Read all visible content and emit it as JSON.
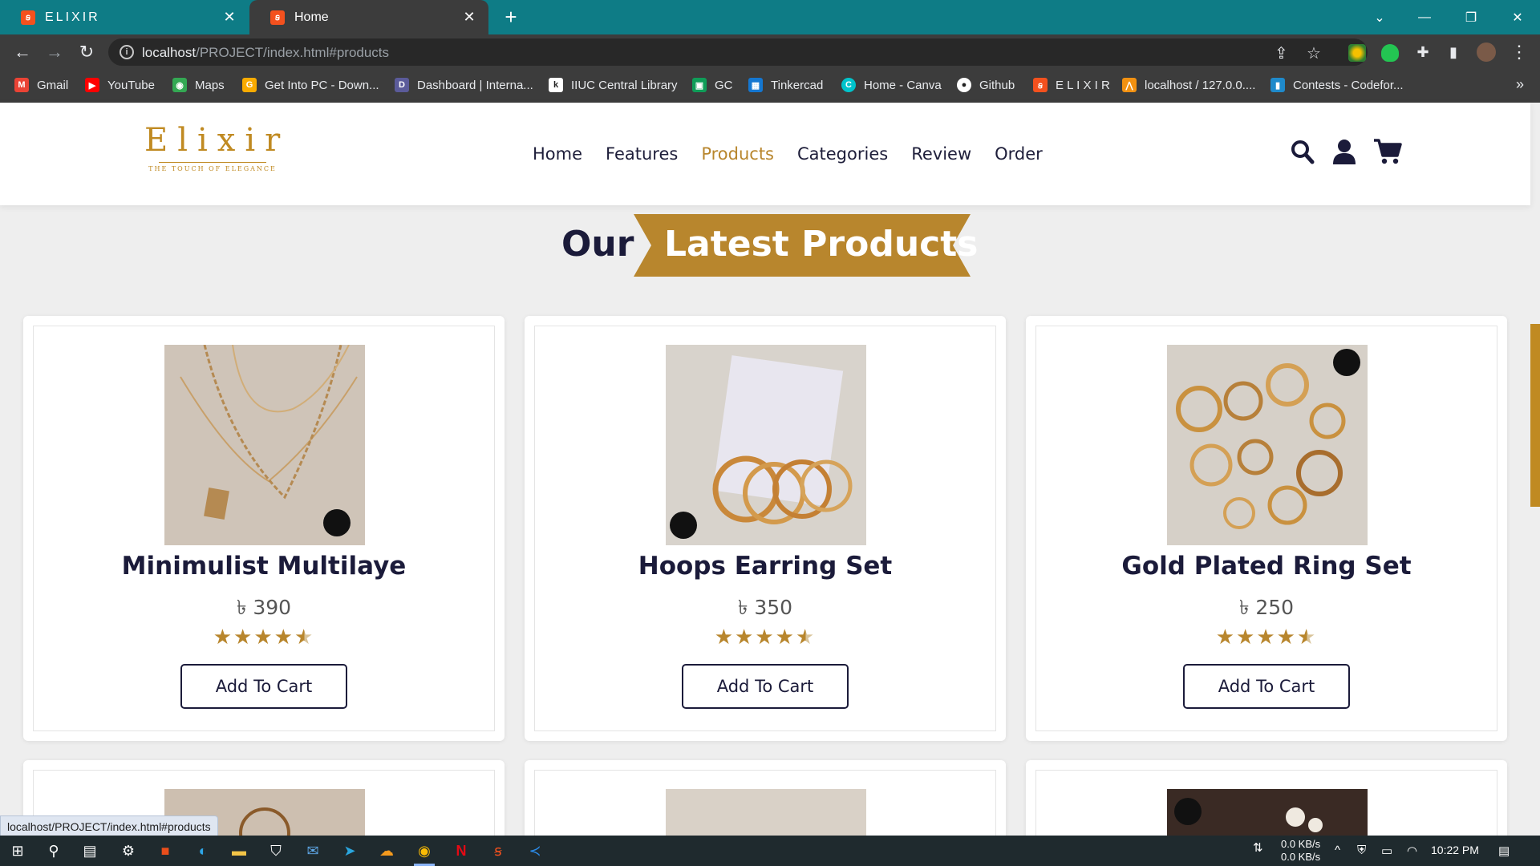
{
  "browser": {
    "tabs": [
      {
        "title": "ELIXIR",
        "active": false
      },
      {
        "title": "Home",
        "active": true
      }
    ],
    "url_host": "localhost",
    "url_path": "/PROJECT/index.html#products",
    "bookmarks": [
      {
        "label": "Gmail",
        "icon": "gmail-icon",
        "color": "#ea4335"
      },
      {
        "label": "YouTube",
        "icon": "youtube-icon",
        "color": "#ff0000"
      },
      {
        "label": "Maps",
        "icon": "maps-icon",
        "color": "#34a853"
      },
      {
        "label": "Get Into PC - Down...",
        "icon": "getintopc-icon",
        "color": "#f9ab00"
      },
      {
        "label": "Dashboard | Interna...",
        "icon": "dashboard-icon",
        "color": "#5b5b9a"
      },
      {
        "label": "IIUC Central Library",
        "icon": "library-icon",
        "color": "#ffffff"
      },
      {
        "label": "GC",
        "icon": "classroom-icon",
        "color": "#0f9d58"
      },
      {
        "label": "Tinkercad",
        "icon": "tinkercad-icon",
        "color": "#1477d1"
      },
      {
        "label": "Home - Canva",
        "icon": "canva-icon",
        "color": "#00c4cc"
      },
      {
        "label": "Github",
        "icon": "github-icon",
        "color": "#ffffff"
      },
      {
        "label": "E L I X I R",
        "icon": "elixir-icon",
        "color": "#f4511e"
      },
      {
        "label": "localhost / 127.0.0....",
        "icon": "phpmyadmin-icon",
        "color": "#f29111"
      },
      {
        "label": "Contests - Codefor...",
        "icon": "codeforces-icon",
        "color": "#1f8acb"
      }
    ],
    "status_url": "localhost/PROJECT/index.html#products"
  },
  "site": {
    "logo_word": "Elixir",
    "logo_tagline": "THE TOUCH OF ELEGANCE",
    "nav": [
      "Home",
      "Features",
      "Products",
      "Categories",
      "Review",
      "Order"
    ],
    "nav_active": "Products",
    "heading_prefix": "Our",
    "heading_main": "Latest Products"
  },
  "products": [
    {
      "name": "Minimulist Multilaye",
      "price": "৳ 390",
      "rating": 4.5,
      "button": "Add To Cart"
    },
    {
      "name": "Hoops Earring Set",
      "price": "৳ 350",
      "rating": 4.5,
      "button": "Add To Cart"
    },
    {
      "name": "Gold Plated Ring Set",
      "price": "৳ 250",
      "rating": 4.5,
      "button": "Add To Cart"
    }
  ],
  "taskbar": {
    "net_down": "0.0 KB/s",
    "net_up": "0.0 KB/s",
    "time": "10:22 PM"
  },
  "colors": {
    "accent_gold": "#b8862d",
    "navy": "#1b1b3a",
    "tabbar": "#0e7c86"
  }
}
